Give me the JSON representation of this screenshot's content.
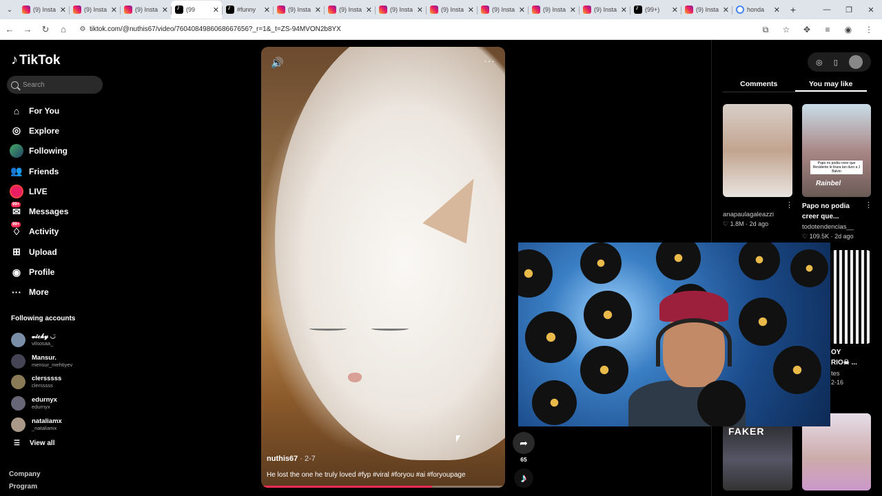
{
  "browser": {
    "tabs": [
      {
        "label": "(9) Insta",
        "favicon": "instagram-icon"
      },
      {
        "label": "(9) Insta",
        "favicon": "instagram-icon"
      },
      {
        "label": "(9) Insta",
        "favicon": "instagram-icon"
      },
      {
        "label": "(99",
        "favicon": "tiktok-icon",
        "active": true
      },
      {
        "label": "#funny",
        "favicon": "tiktok-icon"
      },
      {
        "label": "(9) Insta",
        "favicon": "instagram-icon"
      },
      {
        "label": "(9) Insta",
        "favicon": "instagram-icon"
      },
      {
        "label": "(9) Insta",
        "favicon": "instagram-icon"
      },
      {
        "label": "(9) Insta",
        "favicon": "instagram-icon"
      },
      {
        "label": "(9) Insta",
        "favicon": "instagram-icon"
      },
      {
        "label": "(9) Insta",
        "favicon": "instagram-icon"
      },
      {
        "label": "(9) Insta",
        "favicon": "instagram-icon"
      },
      {
        "label": "(99+)",
        "favicon": "tiktok-icon"
      },
      {
        "label": "(9) Insta",
        "favicon": "instagram-icon"
      },
      {
        "label": "honda",
        "favicon": "google-icon"
      }
    ],
    "url": "tiktok.com/@nuthis67/video/7604084986068667656?_r=1&_t=ZS-94MVON2b8YX"
  },
  "tiktok": {
    "logo": "TikTok",
    "search_placeholder": "Search",
    "nav": [
      {
        "label": "For You",
        "icon": "home-icon"
      },
      {
        "label": "Explore",
        "icon": "compass-icon"
      },
      {
        "label": "Following",
        "icon": "avatar-icon"
      },
      {
        "label": "Friends",
        "icon": "friends-icon"
      },
      {
        "label": "LIVE",
        "icon": "live-icon"
      },
      {
        "label": "Messages",
        "icon": "messages-icon",
        "badge": "99+"
      },
      {
        "label": "Activity",
        "icon": "activity-icon",
        "badge": "99+"
      },
      {
        "label": "Upload",
        "icon": "upload-icon"
      },
      {
        "label": "Profile",
        "icon": "profile-icon"
      },
      {
        "label": "More",
        "icon": "more-icon"
      }
    ],
    "following_header": "Following accounts",
    "following": [
      {
        "name": "𝓿𝓲𝓬𝓴𝔂 ◡̈",
        "handle": "vilsosaa_"
      },
      {
        "name": "Mansur.",
        "handle": "mensur_mehtiyev"
      },
      {
        "name": "clersssss",
        "handle": "clersssss"
      },
      {
        "name": "edurnyx",
        "handle": "edurnyx"
      },
      {
        "name": "nataliamx",
        "handle": "_nataliamx"
      }
    ],
    "view_all": "View all",
    "footer": [
      "Company",
      "Program"
    ]
  },
  "video": {
    "author": "nuthis67",
    "date": " · 2-7",
    "caption": "He lost the one he truly loved #fyp #viral #foryou #ai #foryoupage",
    "progress": 0.7,
    "share_count": "65"
  },
  "right_panel": {
    "tabs": [
      "Comments",
      "You may like"
    ],
    "selected_tab": "You may like",
    "cards": [
      {
        "title": "",
        "author": "anapaulagaleazzi",
        "likes": "1.8M",
        "age": "2d ago"
      },
      {
        "title": "Papo no podia creer que...",
        "author": "todotendencias__",
        "likes": "109.5K",
        "age": "2d ago",
        "thumb_caption": "Papo no podia creer que Residente le tirara tan duro a J Balvin",
        "thumb_label": "Rainbel"
      },
      {
        "thumb_label": "FAKER"
      }
    ],
    "partial_card": {
      "title_1": "OY",
      "title_2": "RIO☠ ...",
      "author": "tes",
      "date": "2-16"
    }
  }
}
